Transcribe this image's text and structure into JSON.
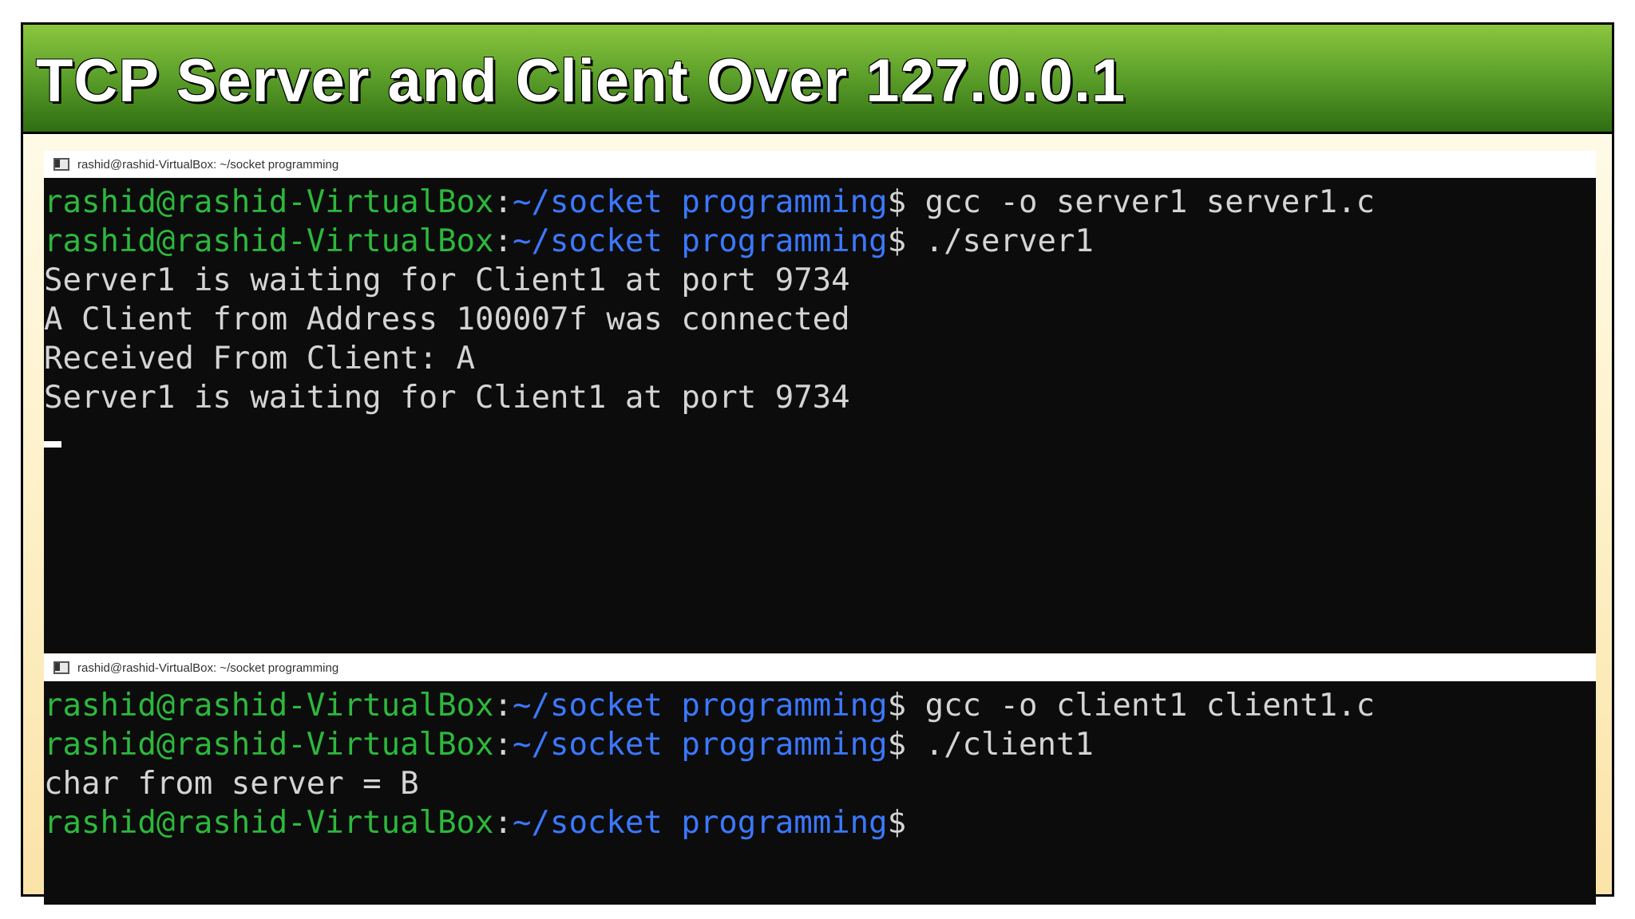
{
  "slide": {
    "title": "TCP Server and Client Over 127.0.0.1"
  },
  "colors": {
    "user_host": "#2db83d",
    "path": "#3b78ff",
    "output": "#d4d4d4",
    "terminal_bg": "#0c0c0c"
  },
  "server_terminal": {
    "window_title": "rashid@rashid-VirtualBox: ~/socket programming",
    "icon": "terminal-window-icon",
    "lines": [
      {
        "user": "rashid@rashid-VirtualBox",
        "colon": ":",
        "path": "~/socket programming",
        "prompt": "$",
        "cmd": " gcc -o server1 server1.c"
      },
      {
        "user": "rashid@rashid-VirtualBox",
        "colon": ":",
        "path": "~/socket programming",
        "prompt": "$",
        "cmd": " ./server1"
      },
      {
        "output": "Server1 is waiting for Client1 at port 9734"
      },
      {
        "output": "A Client from Address 100007f was connected"
      },
      {
        "output": "Received From Client: A"
      },
      {
        "output": "Server1 is waiting for Client1 at port 9734"
      }
    ]
  },
  "client_terminal": {
    "window_title": "rashid@rashid-VirtualBox: ~/socket programming",
    "icon": "terminal-window-icon",
    "lines": [
      {
        "user": "rashid@rashid-VirtualBox",
        "colon": ":",
        "path": "~/socket programming",
        "prompt": "$",
        "cmd": " gcc -o client1 client1.c"
      },
      {
        "user": "rashid@rashid-VirtualBox",
        "colon": ":",
        "path": "~/socket programming",
        "prompt": "$",
        "cmd": " ./client1"
      },
      {
        "output": "char from server = B"
      },
      {
        "user": "rashid@rashid-VirtualBox",
        "colon": ":",
        "path": "~/socket programming",
        "prompt": "$",
        "cmd": ""
      }
    ]
  }
}
